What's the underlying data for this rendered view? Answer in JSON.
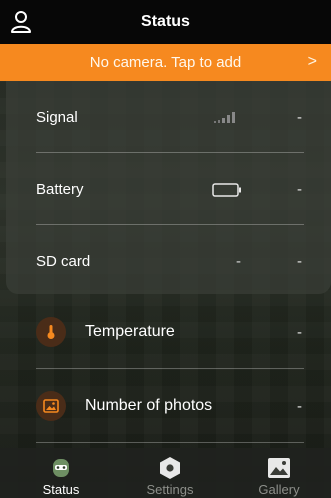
{
  "header": {
    "title": "Status",
    "user_icon": "user-icon"
  },
  "banner": {
    "text": "No camera. Tap to add",
    "chevron": ">",
    "color": "#f6891f"
  },
  "status_rows": [
    {
      "label": "Signal",
      "value": "-",
      "icon": "signal-bars-icon"
    },
    {
      "label": "Battery",
      "value": "-",
      "icon": "battery-icon"
    },
    {
      "label": "SD card",
      "value": "-",
      "secondary": "-"
    }
  ],
  "detail_rows": [
    {
      "label": "Temperature",
      "value": "-",
      "icon": "thermometer-icon",
      "icon_color": "#f6891f"
    },
    {
      "label": "Number of photos",
      "value": "-",
      "icon": "photo-icon",
      "icon_color": "#f6891f"
    }
  ],
  "tabs": [
    {
      "label": "Status",
      "icon": "camera-status-icon",
      "active": true
    },
    {
      "label": "Settings",
      "icon": "hexagon-gear-icon",
      "active": false
    },
    {
      "label": "Gallery",
      "icon": "gallery-icon",
      "active": false
    }
  ],
  "colors": {
    "accent": "#f6891f",
    "header_bg": "#070707",
    "active_tab_icon": "#6e8f63"
  }
}
